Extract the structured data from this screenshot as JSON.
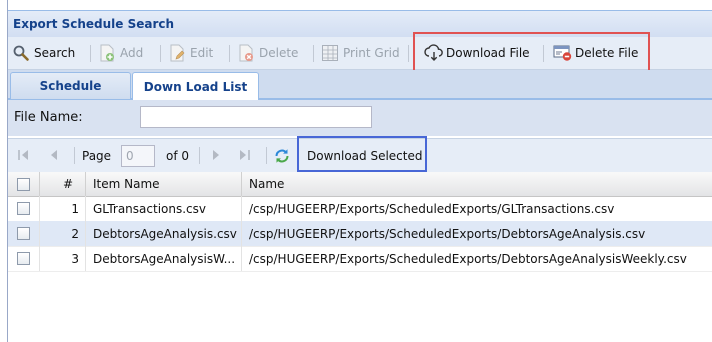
{
  "panel": {
    "title": "Export Schedule Search"
  },
  "toolbar": {
    "search": "Search",
    "add": "Add",
    "edit": "Edit",
    "delete": "Delete",
    "print_grid": "Print Grid",
    "download_file": "Download File",
    "delete_file": "Delete File"
  },
  "tabs": [
    {
      "label": "Schedule",
      "active": false
    },
    {
      "label": "Down Load List",
      "active": true
    }
  ],
  "filter": {
    "file_name_label": "File Name:",
    "file_name_value": ""
  },
  "pager": {
    "page_label": "Page",
    "page_value": "0",
    "of_text": "of 0",
    "download_selected": "Download Selected"
  },
  "grid": {
    "columns": {
      "num": "#",
      "item_name": "Item Name",
      "name": "Name"
    },
    "rows": [
      {
        "num": "1",
        "item_name": "GLTransactions.csv",
        "name": "/csp/HUGEERP/Exports/ScheduledExports/GLTransactions.csv",
        "selected": false
      },
      {
        "num": "2",
        "item_name": "DebtorsAgeAnalysis.csv",
        "name": "/csp/HUGEERP/Exports/ScheduledExports/DebtorsAgeAnalysis.csv",
        "selected": true
      },
      {
        "num": "3",
        "item_name": "DebtorsAgeAnalysisW...",
        "name": "/csp/HUGEERP/Exports/ScheduledExports/DebtorsAgeAnalysisWeekly.csv",
        "selected": false
      }
    ]
  },
  "colors": {
    "accent": "#15428b",
    "highlight_red": "#e05252",
    "highlight_blue": "#4867d6",
    "selected_row": "#dfe8f6"
  }
}
